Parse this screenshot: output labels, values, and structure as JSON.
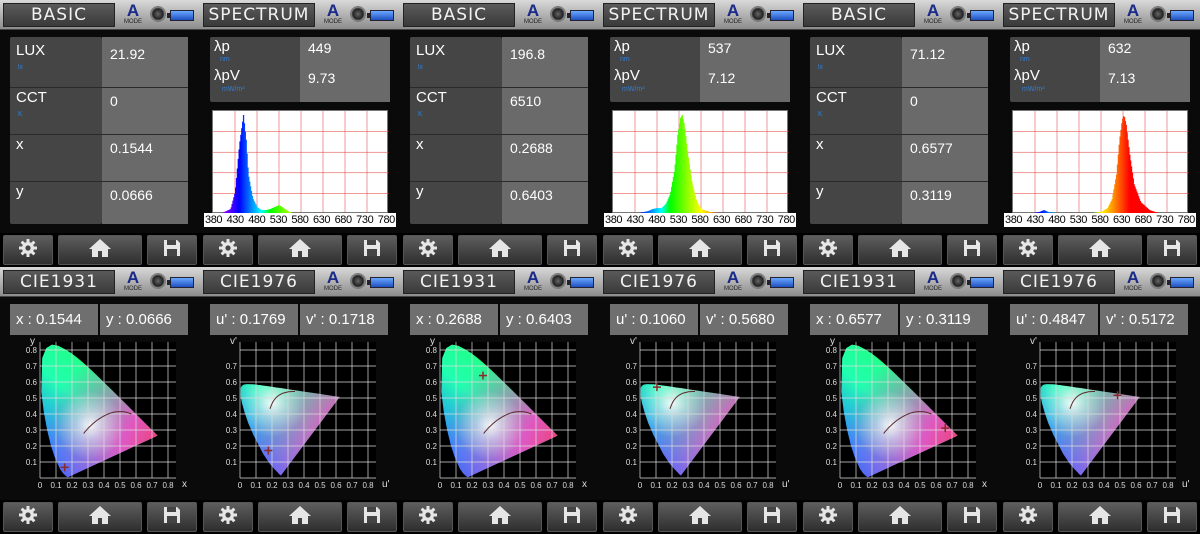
{
  "panels": [
    {
      "type": "basic",
      "title": "BASIC",
      "mode": "A",
      "mode_label": "MODE",
      "labels": {
        "lux": "LUX",
        "lux_unit": "lx",
        "cct": "CCT",
        "cct_unit": "K",
        "x": "x",
        "y": "y"
      },
      "values": {
        "lux": "21.92",
        "cct": "0",
        "x": "0.1544",
        "y": "0.0666"
      }
    },
    {
      "type": "spectrum",
      "title": "SPECTRUM",
      "mode": "A",
      "mode_label": "MODE",
      "labels": {
        "lp": "λp",
        "lp_unit": "nm",
        "lpv": "λpV",
        "lpv_unit": "mW/m²"
      },
      "values": {
        "lp": "449",
        "lpv": "9.73"
      },
      "ticks": [
        "380",
        "430",
        "480",
        "530",
        "580",
        "630",
        "680",
        "730",
        "780"
      ],
      "chart_data": {
        "type": "area",
        "x": [
          380,
          400,
          420,
          430,
          440,
          449,
          455,
          460,
          470,
          480,
          490,
          500,
          510,
          520,
          530,
          540,
          550,
          560,
          580,
          630,
          680,
          730,
          780
        ],
        "y": [
          0,
          0.01,
          0.05,
          0.22,
          0.7,
          1.0,
          0.75,
          0.4,
          0.16,
          0.07,
          0.04,
          0.04,
          0.05,
          0.07,
          0.09,
          0.06,
          0.03,
          0.01,
          0.005,
          0,
          0,
          0,
          0
        ],
        "xlim": [
          380,
          780
        ],
        "ylim": [
          0,
          1
        ]
      }
    },
    {
      "type": "basic",
      "title": "BASIC",
      "mode": "A",
      "mode_label": "MODE",
      "labels": {
        "lux": "LUX",
        "lux_unit": "lx",
        "cct": "CCT",
        "cct_unit": "K",
        "x": "x",
        "y": "y"
      },
      "values": {
        "lux": "196.8",
        "cct": "6510",
        "x": "0.2688",
        "y": "0.6403"
      }
    },
    {
      "type": "spectrum",
      "title": "SPECTRUM",
      "mode": "A",
      "mode_label": "MODE",
      "labels": {
        "lp": "λp",
        "lp_unit": "nm",
        "lpv": "λpV",
        "lpv_unit": "mW/m²"
      },
      "values": {
        "lp": "537",
        "lpv": "7.12"
      },
      "ticks": [
        "380",
        "430",
        "480",
        "530",
        "580",
        "630",
        "680",
        "730",
        "780"
      ],
      "chart_data": {
        "type": "area",
        "x": [
          380,
          420,
          440,
          460,
          470,
          480,
          490,
          500,
          510,
          520,
          527,
          533,
          537,
          542,
          550,
          560,
          570,
          580,
          600,
          630,
          680,
          730,
          780
        ],
        "y": [
          0,
          0.005,
          0.01,
          0.03,
          0.05,
          0.06,
          0.06,
          0.1,
          0.2,
          0.45,
          0.8,
          0.97,
          1.0,
          0.9,
          0.6,
          0.3,
          0.13,
          0.05,
          0.02,
          0.005,
          0,
          0,
          0
        ],
        "xlim": [
          380,
          780
        ],
        "ylim": [
          0,
          1
        ]
      }
    },
    {
      "type": "basic",
      "title": "BASIC",
      "mode": "A",
      "mode_label": "MODE",
      "labels": {
        "lux": "LUX",
        "lux_unit": "lx",
        "cct": "CCT",
        "cct_unit": "K",
        "x": "x",
        "y": "y"
      },
      "values": {
        "lux": "71.12",
        "cct": "0",
        "x": "0.6577",
        "y": "0.3119"
      }
    },
    {
      "type": "spectrum",
      "title": "SPECTRUM",
      "mode": "A",
      "mode_label": "MODE",
      "labels": {
        "lp": "λp",
        "lp_unit": "nm",
        "lpv": "λpV",
        "lpv_unit": "mW/m²"
      },
      "values": {
        "lp": "632",
        "lpv": "7.13"
      },
      "ticks": [
        "380",
        "430",
        "480",
        "530",
        "580",
        "630",
        "680",
        "730",
        "780"
      ],
      "chart_data": {
        "type": "area",
        "x": [
          380,
          420,
          440,
          450,
          460,
          480,
          500,
          520,
          540,
          560,
          580,
          595,
          605,
          615,
          622,
          628,
          632,
          637,
          645,
          655,
          670,
          690,
          710,
          730,
          780
        ],
        "y": [
          0,
          0.005,
          0.02,
          0.04,
          0.02,
          0.01,
          0.01,
          0.01,
          0.01,
          0.01,
          0.02,
          0.06,
          0.15,
          0.4,
          0.75,
          0.95,
          1.0,
          0.9,
          0.6,
          0.3,
          0.12,
          0.04,
          0.01,
          0,
          0
        ],
        "xlim": [
          380,
          780
        ],
        "ylim": [
          0,
          1
        ]
      }
    },
    {
      "type": "cie1931",
      "title": "CIE1931",
      "mode": "A",
      "mode_label": "MODE",
      "coord1_text": "x : 0.1544",
      "coord2_text": "y : 0.0666",
      "axis_y": "y",
      "axis_x": "x",
      "yticks": [
        "0.8",
        "0.7",
        "0.6",
        "0.5",
        "0.4",
        "0.3",
        "0.2",
        "0.1"
      ],
      "xticks": [
        "0",
        "0.1",
        "0.2",
        "0.3",
        "0.4",
        "0.5",
        "0.6",
        "0.7",
        "0.8"
      ],
      "point": {
        "x": 0.1544,
        "y": 0.0666
      }
    },
    {
      "type": "cie1976",
      "title": "CIE1976",
      "mode": "A",
      "mode_label": "MODE",
      "coord1_text": "u' : 0.1769",
      "coord2_text": "v' : 0.1718",
      "axis_y": "v'",
      "axis_x": "u'",
      "yticks": [
        "0.7",
        "0.6",
        "0.5",
        "0.4",
        "0.3",
        "0.2",
        "0.1"
      ],
      "xticks": [
        "0",
        "0.1",
        "0.2",
        "0.3",
        "0.4",
        "0.5",
        "0.6",
        "0.7",
        "0.8"
      ],
      "point": {
        "u": 0.1769,
        "v": 0.1718
      }
    },
    {
      "type": "cie1931",
      "title": "CIE1931",
      "mode": "A",
      "mode_label": "MODE",
      "coord1_text": "x : 0.2688",
      "coord2_text": "y : 0.6403",
      "axis_y": "y",
      "axis_x": "x",
      "yticks": [
        "0.8",
        "0.7",
        "0.6",
        "0.5",
        "0.4",
        "0.3",
        "0.2",
        "0.1"
      ],
      "xticks": [
        "0",
        "0.1",
        "0.2",
        "0.3",
        "0.4",
        "0.5",
        "0.6",
        "0.7",
        "0.8"
      ],
      "point": {
        "x": 0.2688,
        "y": 0.6403
      }
    },
    {
      "type": "cie1976",
      "title": "CIE1976",
      "mode": "A",
      "mode_label": "MODE",
      "coord1_text": "u' : 0.1060",
      "coord2_text": "v' : 0.5680",
      "axis_y": "v'",
      "axis_x": "u'",
      "yticks": [
        "0.7",
        "0.6",
        "0.5",
        "0.4",
        "0.3",
        "0.2",
        "0.1"
      ],
      "xticks": [
        "0",
        "0.1",
        "0.2",
        "0.3",
        "0.4",
        "0.5",
        "0.6",
        "0.7",
        "0.8"
      ],
      "point": {
        "u": 0.106,
        "v": 0.568
      }
    },
    {
      "type": "cie1931",
      "title": "CIE1931",
      "mode": "A",
      "mode_label": "MODE",
      "coord1_text": "x : 0.6577",
      "coord2_text": "y : 0.3119",
      "axis_y": "y",
      "axis_x": "x",
      "yticks": [
        "0.8",
        "0.7",
        "0.6",
        "0.5",
        "0.4",
        "0.3",
        "0.2",
        "0.1"
      ],
      "xticks": [
        "0",
        "0.1",
        "0.2",
        "0.3",
        "0.4",
        "0.5",
        "0.6",
        "0.7",
        "0.8"
      ],
      "point": {
        "x": 0.6577,
        "y": 0.3119
      }
    },
    {
      "type": "cie1976",
      "title": "CIE1976",
      "mode": "A",
      "mode_label": "MODE",
      "coord1_text": "u' : 0.4847",
      "coord2_text": "v' : 0.5172",
      "axis_y": "v'",
      "axis_x": "u'",
      "yticks": [
        "0.7",
        "0.6",
        "0.5",
        "0.4",
        "0.3",
        "0.2",
        "0.1"
      ],
      "xticks": [
        "0",
        "0.1",
        "0.2",
        "0.3",
        "0.4",
        "0.5",
        "0.6",
        "0.7",
        "0.8"
      ],
      "point": {
        "u": 0.4847,
        "v": 0.5172
      }
    }
  ],
  "footer_icons": [
    "gear-icon",
    "home-icon",
    "save-icon"
  ],
  "colors": {
    "label_unit": "#2f7fd8",
    "panel_box": "#454545",
    "value_box": "#6a6a6a",
    "marker": "#8a2a2a"
  }
}
